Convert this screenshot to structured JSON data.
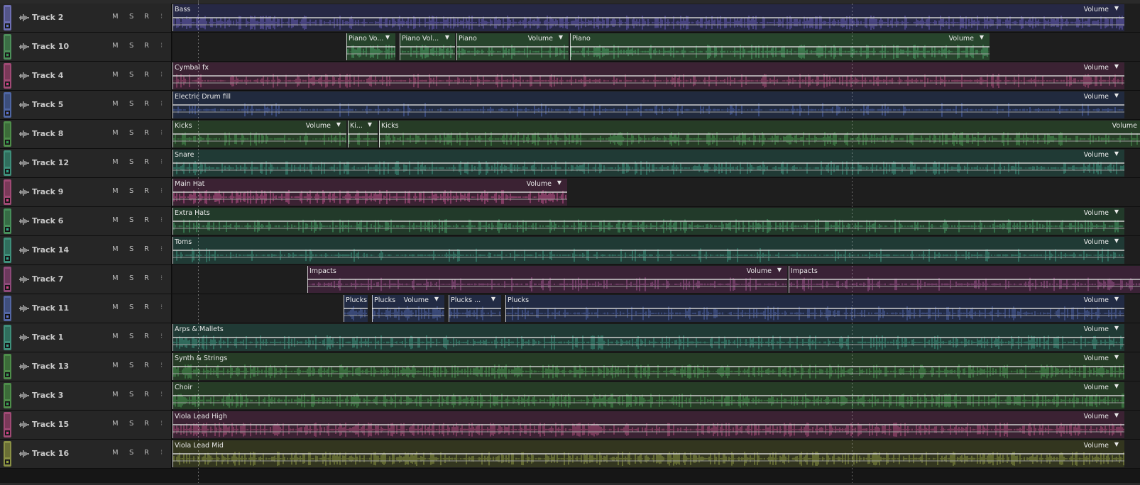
{
  "colors": {
    "blue": "#5b6fd4",
    "green": "#2f9f4f",
    "pink": "#d83a86",
    "teal": "#2aa98c",
    "olive": "#9aa83a"
  },
  "volume_label": "Volume",
  "buttons": {
    "mute": "M",
    "solo": "S",
    "record": "R"
  },
  "tracks": [
    {
      "name": "Track 2",
      "color": "blue",
      "bar": "#6e6fb3",
      "clips": [
        {
          "name": "Bass",
          "start": 0,
          "end": 1341,
          "bg": "#262845",
          "wave": "#6a5fb8",
          "vol": true,
          "hasArrow": true,
          "density": 0.6
        }
      ]
    },
    {
      "name": "Track 10",
      "color": "green",
      "bar": "#4d8f5a",
      "clips": [
        {
          "name": "Piano Vo...",
          "start": 245,
          "end": 314,
          "bg": "#27442c",
          "wave": "#4fa76a",
          "vol": false,
          "hasArrow": true,
          "density": 0.5
        },
        {
          "name": "Piano Vol...",
          "start": 320,
          "end": 398,
          "bg": "#27442c",
          "wave": "#4fa76a",
          "vol": false,
          "hasArrow": true,
          "density": 0.5
        },
        {
          "name": "Piano",
          "start": 400,
          "end": 558,
          "bg": "#27442c",
          "wave": "#4fa76a",
          "vol": true,
          "hasArrow": true,
          "density": 0.4
        },
        {
          "name": "Piano",
          "start": 560,
          "end": 1151,
          "bg": "#27442c",
          "wave": "#4fa76a",
          "vol": true,
          "hasArrow": true,
          "density": 0.4
        }
      ]
    },
    {
      "name": "Track 4",
      "color": "pink",
      "bar": "#a04a75",
      "clips": [
        {
          "name": "Cymbal fx",
          "start": 0,
          "end": 1341,
          "bg": "#3b2233",
          "wave": "#b4517f",
          "vol": true,
          "hasArrow": true,
          "density": 0.3
        }
      ]
    },
    {
      "name": "Track 5",
      "color": "blue",
      "bar": "#4f66a3",
      "clips": [
        {
          "name": "Electric Drum fill",
          "start": 0,
          "end": 1341,
          "bg": "#212a3e",
          "wave": "#4f67b3",
          "vol": true,
          "hasArrow": true,
          "density": 0.15
        }
      ]
    },
    {
      "name": "Track 8",
      "color": "green",
      "bar": "#4e8d4a",
      "clips": [
        {
          "name": "Kicks",
          "start": 0,
          "end": 245,
          "bg": "#263c26",
          "wave": "#4a9a55",
          "vol": true,
          "hasArrow": true,
          "density": 0.3
        },
        {
          "name": "Ki...",
          "start": 247,
          "end": 289,
          "bg": "#263c26",
          "wave": "#4a9a55",
          "vol": false,
          "hasArrow": true,
          "density": 0.3
        },
        {
          "name": "Kicks",
          "start": 291,
          "end": 1363,
          "bg": "#263c26",
          "wave": "#4a9a55",
          "vol": true,
          "hasArrow": false,
          "density": 0.4
        }
      ]
    },
    {
      "name": "Track 12",
      "color": "teal",
      "bar": "#3f8f7a",
      "clips": [
        {
          "name": "Snare",
          "start": 0,
          "end": 1341,
          "bg": "#203a35",
          "wave": "#3f9a84",
          "vol": true,
          "hasArrow": true,
          "density": 0.35
        }
      ]
    },
    {
      "name": "Track 9",
      "color": "pink",
      "bar": "#a04a75",
      "clips": [
        {
          "name": "Main Hat",
          "start": 0,
          "end": 556,
          "bg": "#3b2233",
          "wave": "#c65590",
          "vol": true,
          "hasArrow": true,
          "density": 0.5
        }
      ]
    },
    {
      "name": "Track 6",
      "color": "teal",
      "bar": "#478e5a",
      "clips": [
        {
          "name": "Extra Hats",
          "start": 0,
          "end": 1341,
          "bg": "#223a2a",
          "wave": "#48a26a",
          "vol": true,
          "hasArrow": true,
          "density": 0.35
        }
      ]
    },
    {
      "name": "Track 14",
      "color": "teal",
      "bar": "#3f8f7a",
      "clips": [
        {
          "name": "Toms",
          "start": 0,
          "end": 1341,
          "bg": "#203a35",
          "wave": "#3f9a84",
          "vol": true,
          "hasArrow": true,
          "density": 0.15
        }
      ]
    },
    {
      "name": "Track 7",
      "color": "pink",
      "bar": "#8e4a7a",
      "clips": [
        {
          "name": "Impacts",
          "start": 190,
          "end": 866,
          "bg": "#3a2236",
          "wave": "#a15692",
          "vol": true,
          "hasArrow": true,
          "density": 0.2
        },
        {
          "name": "Impacts",
          "start": 868,
          "end": 1363,
          "bg": "#3a2236",
          "wave": "#a15692",
          "vol": false,
          "hasArrow": false,
          "density": 0.3
        }
      ]
    },
    {
      "name": "Track 11",
      "color": "blue",
      "bar": "#5467a4",
      "clips": [
        {
          "name": "Plucks",
          "start": 241,
          "end": 275,
          "bg": "#222b44",
          "wave": "#5066a8",
          "vol": false,
          "hasArrow": false,
          "density": 0.5
        },
        {
          "name": "Plucks",
          "start": 281,
          "end": 383,
          "bg": "#222b44",
          "wave": "#5066a8",
          "vol": true,
          "hasArrow": true,
          "density": 0.5
        },
        {
          "name": "Plucks ...",
          "start": 389,
          "end": 463,
          "bg": "#222b44",
          "wave": "#5066a8",
          "vol": false,
          "hasArrow": true,
          "density": 0.5
        },
        {
          "name": "Plucks",
          "start": 469,
          "end": 1341,
          "bg": "#222b44",
          "wave": "#5066a8",
          "vol": true,
          "hasArrow": true,
          "density": 0.3
        }
      ]
    },
    {
      "name": "Track 1",
      "color": "teal",
      "bar": "#3f8f7a",
      "clips": [
        {
          "name": "Arps & Mallets",
          "start": 0,
          "end": 1341,
          "bg": "#203a35",
          "wave": "#3f9a84",
          "vol": true,
          "hasArrow": true,
          "density": 0.35
        }
      ]
    },
    {
      "name": "Track 13",
      "color": "green",
      "bar": "#4e8d4a",
      "clips": [
        {
          "name": "Synth & Strings",
          "start": 0,
          "end": 1341,
          "bg": "#263c26",
          "wave": "#4a9a55",
          "vol": true,
          "hasArrow": true,
          "density": 0.55
        }
      ]
    },
    {
      "name": "Track 3",
      "color": "green",
      "bar": "#4e8d4a",
      "clips": [
        {
          "name": "Choir",
          "start": 0,
          "end": 1341,
          "bg": "#263c26",
          "wave": "#4a9a55",
          "vol": true,
          "hasArrow": true,
          "density": 0.5
        }
      ]
    },
    {
      "name": "Track 15",
      "color": "pink",
      "bar": "#a04a75",
      "clips": [
        {
          "name": "Viola Lead High",
          "start": 0,
          "end": 1341,
          "bg": "#3b2233",
          "wave": "#b4517f",
          "vol": true,
          "hasArrow": true,
          "density": 0.5
        }
      ]
    },
    {
      "name": "Track 16",
      "color": "olive",
      "bar": "#8a9145",
      "clips": [
        {
          "name": "Viola Lead Mid",
          "start": 0,
          "end": 1341,
          "bg": "#33361f",
          "wave": "#8e9a44",
          "vol": true,
          "hasArrow": true,
          "density": 0.55
        }
      ]
    }
  ]
}
